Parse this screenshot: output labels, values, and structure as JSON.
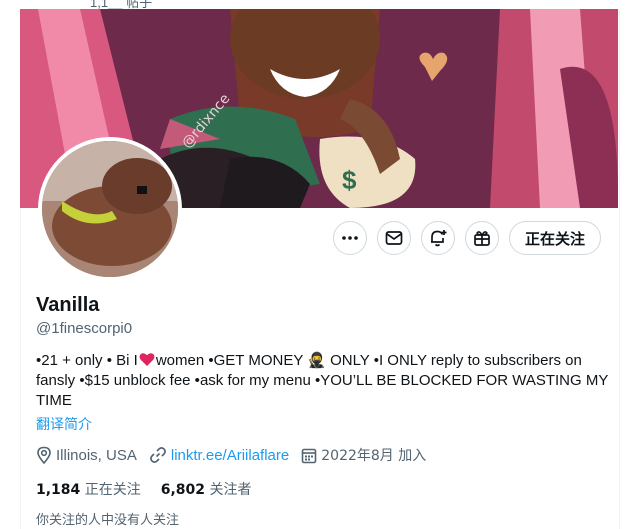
{
  "top": {
    "partial_text": "1,1__ 帖子"
  },
  "profile": {
    "name": "Vanilla",
    "handle": "@1finescorpi0",
    "bio_part1": "•21 + only • Bi I",
    "bio_part2": "women •GET MONEY 🥷 ONLY •I ONLY reply to subscribers on fansly •$15 unblock fee •ask for my menu •YOU’LL BE BLOCKED FOR WASTING MY TIME",
    "translate_label": "翻译简介",
    "location": "Illinois, USA",
    "link": "linktr.ee/Ariilaflare",
    "joined": "2022年8月 加入",
    "following_count": "1,184",
    "following_label": "正在关注",
    "followers_count": "6,802",
    "followers_label": "关注者",
    "mutual_text": "你关注的人中没有人关注"
  },
  "actions": {
    "more_icon": "more-icon",
    "message_icon": "mail-icon",
    "notify_icon": "bell-plus-icon",
    "subscribe_icon": "gift-icon",
    "follow_label": "正在关注"
  },
  "banner": {
    "signature": "@rdixnce"
  },
  "colors": {
    "link": "#1d9bf0",
    "muted": "#536471",
    "text": "#0f1419",
    "heart": "#e0245e"
  }
}
